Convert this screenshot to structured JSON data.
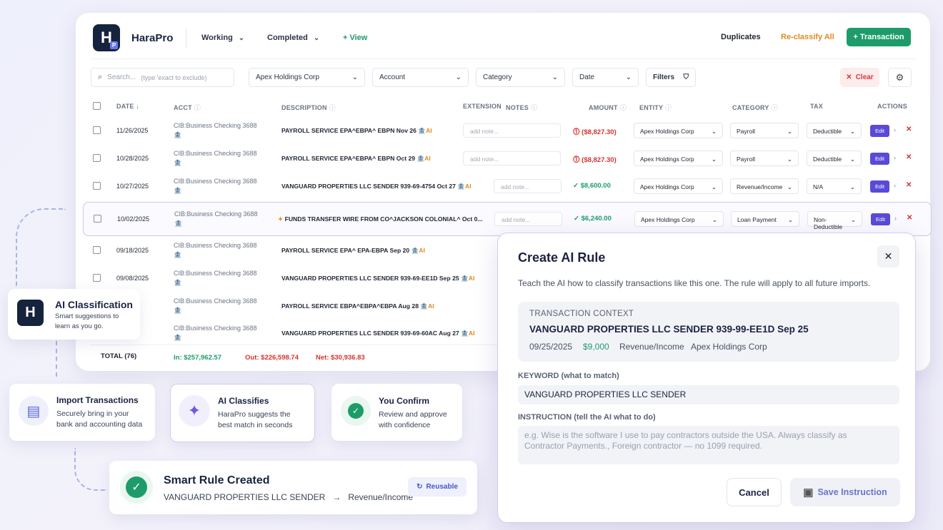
{
  "header": {
    "brand": "HaraPro",
    "logo_letter": "H",
    "logo_sub": "P",
    "working": "Working",
    "completed": "Completed",
    "view": "+ View",
    "duplicates": "Duplicates",
    "reclassify": "Re-classify All",
    "transaction_btn": "+ Transaction"
  },
  "filters": {
    "search_placeholder": "Search...",
    "search_hint": "(type 'exact to exclude)",
    "entity": "Apex Holdings Corp",
    "account": "Account",
    "category": "Category",
    "date": "Date",
    "filters": "Filters",
    "clear": "Clear"
  },
  "columns": {
    "date": "DATE",
    "acct": "ACCT",
    "description": "DESCRIPTION",
    "extension": "EXTENSION",
    "notes": "NOTES",
    "amount": "AMOUNT",
    "entity": "ENTITY",
    "category": "CATEGORY",
    "tax": "TAX",
    "actions": "ACTIONS"
  },
  "rows": [
    {
      "date": "11/26/2025",
      "acct": "CIB:Business Checking 3688",
      "desc": "PAYROLL SERVICE EPA^EBPA^ EBPN Nov 26",
      "note": "add note...",
      "amount": "($8,827.30)",
      "entity": "Apex Holdings Corp",
      "category": "Payroll",
      "tax": "Deductible",
      "edit": "Edit"
    },
    {
      "date": "10/28/2025",
      "acct": "CIB:Business Checking 3688",
      "desc": "PAYROLL SERVICE EPA^EBPA^ EBPN Oct 29",
      "note": "add note...",
      "amount": "($8,827.30)",
      "entity": "Apex Holdings Corp",
      "category": "Payroll",
      "tax": "Deductible",
      "edit": "Edit"
    },
    {
      "date": "10/27/2025",
      "acct": "CIB:Business Checking 3688",
      "desc": "VANGUARD PROPERTIES LLC SENDER 939-69-4754 Oct 27",
      "note": "add note...",
      "amount": "$8,600.00",
      "entity": "Apex Holdings Corp",
      "category": "Revenue/Income",
      "tax": "N/A",
      "edit": "Edit"
    },
    {
      "date": "10/02/2025",
      "acct": "CIB:Business Checking 3688",
      "desc": "FUNDS TRANSFER WIRE FROM CO^JACKSON COLONIAL^ Oct 0...",
      "note": "add note...",
      "amount": "$6,240.00",
      "entity": "Apex Holdings Corp",
      "category": "Loan Payment",
      "tax": "Non-Deductible",
      "edit": "Edit"
    },
    {
      "date": "09/18/2025",
      "acct": "CIB:Business Checking 3688",
      "desc": "PAYROLL SERVICE EPA^ EPA-EBPA Sep 20"
    },
    {
      "date": "09/08/2025",
      "acct": "CIB:Business Checking 3688",
      "desc": "VANGUARD PROPERTIES LLC SENDER 939-69-EE1D Sep 25"
    },
    {
      "date": "",
      "acct": "CIB:Business Checking 3688",
      "desc": "PAYROLL SERVICE EBPA^EBPA^EBPA Aug 28"
    },
    {
      "date": "",
      "acct": "CIB:Business Checking 3688",
      "desc": "VANGUARD PROPERTIES LLC SENDER 939-69-60AC Aug 27"
    }
  ],
  "ai_tag": "AI",
  "totals": {
    "label": "TOTAL (76)",
    "in": "In: $257,962.57",
    "out": "Out: $226,598.74",
    "net": "Net: $30,936.83"
  },
  "side": {
    "ai_class_title": "AI Classification",
    "ai_class_sub1": "Smart suggestions to",
    "ai_class_sub2": "learn as you go.",
    "import_title": "Import Transactions",
    "import_sub1": "Securely bring in your",
    "import_sub2": "bank and accounting data",
    "classify_title": "AI Classifies",
    "classify_sub1": "HaraPro suggests the",
    "classify_sub2": "best match in seconds",
    "confirm_title": "You Confirm",
    "confirm_sub1": "Review and approve",
    "confirm_sub2": "with confidence",
    "rule_title": "Smart Rule Created",
    "rule_keyword": "VANGUARD PROPERTIES LLC SENDER",
    "rule_arrow": "→",
    "rule_target": "Revenue/Income",
    "reusable": "Reusable"
  },
  "modal": {
    "title": "Create AI Rule",
    "subtitle": "Teach the AI how to classify transactions like this one. The rule will apply to all future imports.",
    "context_label": "TRANSACTION CONTEXT",
    "context_value": "VANGUARD PROPERTIES LLC SENDER 939-99-EE1D Sep 25",
    "context_date": "09/25/2025",
    "context_amount": "$9,000",
    "context_category": "Revenue/Income",
    "context_entity": "Apex Holdings Corp",
    "keyword_label": "KEYWORD",
    "keyword_hint": "(what to match)",
    "keyword_value": "VANGUARD PROPERTIES LLC SENDER",
    "instruction_label": "INSTRUCTION",
    "instruction_hint": "(tell the AI what to do)",
    "instruction_placeholder_1": "e.g. Wise is the software I use to pay contractors outside the USA. Always classify as",
    "instruction_placeholder_2": "Contractor Payments., Foreign contractor — no 1099 required.",
    "cancel": "Cancel",
    "save": "Save Instruction"
  }
}
